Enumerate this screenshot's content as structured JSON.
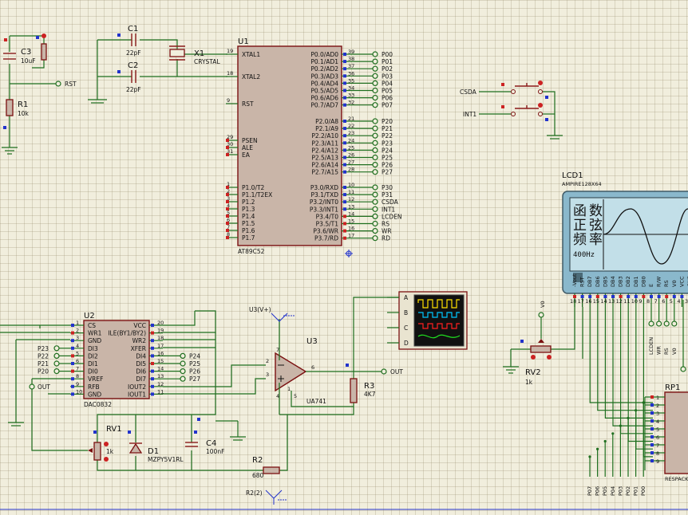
{
  "components": {
    "u1": {
      "ref": "U1",
      "part": "AT89C52"
    },
    "u2": {
      "ref": "U2",
      "part": "DAC0832"
    },
    "u3": {
      "ref": "U3",
      "part": "UA741"
    },
    "c1": {
      "ref": "C1",
      "value": "22pF"
    },
    "c2": {
      "ref": "C2",
      "value": "22pF"
    },
    "c3": {
      "ref": "C3",
      "value": "10uF"
    },
    "c4": {
      "ref": "C4",
      "value": "100nF"
    },
    "x1": {
      "ref": "X1",
      "value": "CRYSTAL"
    },
    "r1": {
      "ref": "R1",
      "value": "10k"
    },
    "r2": {
      "ref": "R2",
      "value": "680"
    },
    "r3": {
      "ref": "R3",
      "value": "4K7"
    },
    "rv1": {
      "ref": "RV1",
      "value": "1k"
    },
    "rv2": {
      "ref": "RV2",
      "value": "1k"
    },
    "d1": {
      "ref": "D1",
      "value": "MZPY5V1RL"
    },
    "lcd1": {
      "ref": "LCD1",
      "part": "AMPIRE128X64"
    },
    "rp1": {
      "ref": "RP1",
      "part": "RESPACK"
    }
  },
  "u1_left_pins": [
    {
      "num": "19",
      "name": "XTAL1"
    },
    {
      "num": "18",
      "name": "XTAL2"
    },
    {
      "num": "9",
      "name": "RST"
    },
    {
      "num": "29",
      "name": "PSEN"
    },
    {
      "num": "30",
      "name": "ALE"
    },
    {
      "num": "31",
      "name": "EA"
    },
    {
      "num": "1",
      "name": "P1.0/T2"
    },
    {
      "num": "2",
      "name": "P1.1/T2EX"
    },
    {
      "num": "3",
      "name": "P1.2"
    },
    {
      "num": "4",
      "name": "P1.3"
    },
    {
      "num": "5",
      "name": "P1.4"
    },
    {
      "num": "6",
      "name": "P1.5"
    },
    {
      "num": "7",
      "name": "P1.6"
    },
    {
      "num": "8",
      "name": "P1.7"
    }
  ],
  "u1_right_pins": [
    {
      "num": "39",
      "name": "P0.0/AD0",
      "net": "P00"
    },
    {
      "num": "38",
      "name": "P0.1/AD1",
      "net": "P01"
    },
    {
      "num": "37",
      "name": "P0.2/AD2",
      "net": "P02"
    },
    {
      "num": "36",
      "name": "P0.3/AD3",
      "net": "P03"
    },
    {
      "num": "35",
      "name": "P0.4/AD4",
      "net": "P04"
    },
    {
      "num": "34",
      "name": "P0.5/AD5",
      "net": "P05"
    },
    {
      "num": "33",
      "name": "P0.6/AD6",
      "net": "P06"
    },
    {
      "num": "32",
      "name": "P0.7/AD7",
      "net": "P07"
    },
    {
      "num": "21",
      "name": "P2.0/A8",
      "net": "P20"
    },
    {
      "num": "22",
      "name": "P2.1/A9",
      "net": "P21"
    },
    {
      "num": "23",
      "name": "P2.2/A10",
      "net": "P22"
    },
    {
      "num": "24",
      "name": "P2.3/A11",
      "net": "P23"
    },
    {
      "num": "25",
      "name": "P2.4/A12",
      "net": "P24"
    },
    {
      "num": "26",
      "name": "P2.5/A13",
      "net": "P25"
    },
    {
      "num": "27",
      "name": "P2.6/A14",
      "net": "P26"
    },
    {
      "num": "28",
      "name": "P2.7/A15",
      "net": "P27"
    },
    {
      "num": "10",
      "name": "P3.0/RXD",
      "net": "P30"
    },
    {
      "num": "11",
      "name": "P3.1/TXD",
      "net": "P31"
    },
    {
      "num": "12",
      "name": "P3.2/INT0",
      "net": "CSDA"
    },
    {
      "num": "13",
      "name": "P3.3/INT1",
      "net": "INT1"
    },
    {
      "num": "14",
      "name": "P3.4/T0",
      "net": "LCDEN"
    },
    {
      "num": "15",
      "name": "P3.5/T1",
      "net": "RS"
    },
    {
      "num": "16",
      "name": "P3.6/WR",
      "net": "WR"
    },
    {
      "num": "17",
      "name": "P3.7/RD",
      "net": "RD"
    }
  ],
  "u2_left_pins": [
    {
      "num": "1",
      "name": "CS"
    },
    {
      "num": "2",
      "name": "WR1"
    },
    {
      "num": "3",
      "name": "GND"
    },
    {
      "num": "4",
      "name": "DI3",
      "net": "P23"
    },
    {
      "num": "5",
      "name": "DI2",
      "net": "P22"
    },
    {
      "num": "6",
      "name": "DI1",
      "net": "P21"
    },
    {
      "num": "7",
      "name": "DI0",
      "net": "P20"
    },
    {
      "num": "8",
      "name": "VREF"
    },
    {
      "num": "9",
      "name": "RFB",
      "net": "OUT"
    },
    {
      "num": "10",
      "name": "GND"
    }
  ],
  "u2_right_pins": [
    {
      "num": "20",
      "name": "VCC"
    },
    {
      "num": "19",
      "name": "ILE(BY1/BY2)"
    },
    {
      "num": "18",
      "name": "WR2"
    },
    {
      "num": "17",
      "name": "XFER"
    },
    {
      "num": "16",
      "name": "DI4",
      "net": "P24"
    },
    {
      "num": "15",
      "name": "DI5",
      "net": "P25"
    },
    {
      "num": "14",
      "name": "DI6",
      "net": "P26"
    },
    {
      "num": "13",
      "name": "DI7",
      "net": "P27"
    },
    {
      "num": "12",
      "name": "IOUT2"
    },
    {
      "num": "11",
      "name": "IOUT1"
    }
  ],
  "u3_pins": {
    "in_minus": "2",
    "in_plus": "3",
    "out": "6",
    "v_plus": "7",
    "v_minus": "4",
    "offset": "5",
    "offset2": "1"
  },
  "nets": {
    "rst": "RST",
    "out": "OUT",
    "csda": "CSDA",
    "int1": "INT1",
    "u3_vplus": "U3(V+)",
    "r2_pin": "R2(2)",
    "v0": "V0"
  },
  "scope_channels": [
    "A",
    "B",
    "C",
    "D"
  ],
  "lcd": {
    "screen_chars": [
      "函",
      "数",
      "正",
      "弦",
      "频",
      "率"
    ],
    "freq_text": "400Hz",
    "pins": [
      "-Vout",
      "RST",
      "DB7",
      "DB6",
      "DB5",
      "DB4",
      "DB3",
      "DB2",
      "DB1",
      "DB0",
      "E",
      "R/W",
      "RS",
      "V0",
      "VCC",
      "GND"
    ],
    "pin_nums": [
      "18",
      "17",
      "16",
      "15",
      "14",
      "13",
      "12",
      "11",
      "10",
      "9",
      "8",
      "7",
      "6",
      "5",
      "4",
      "3"
    ],
    "nets_below": [
      "LCDEN",
      "WR",
      "RS",
      "V0"
    ]
  },
  "rp1_pins": [
    "1",
    "2",
    "3",
    "4",
    "5",
    "6",
    "7",
    "8",
    "9"
  ],
  "bottom_bus_labels": [
    "P07",
    "P06",
    "P05",
    "P04",
    "P03",
    "P02",
    "P01",
    "P00"
  ],
  "colors": {
    "wire": "#1e6e1e",
    "chip_fill": "#c9b5a8",
    "chip_border": "#7a1010",
    "lcd_bg": "#8ab8cc",
    "lcd_screen": "#c2dfe8"
  }
}
